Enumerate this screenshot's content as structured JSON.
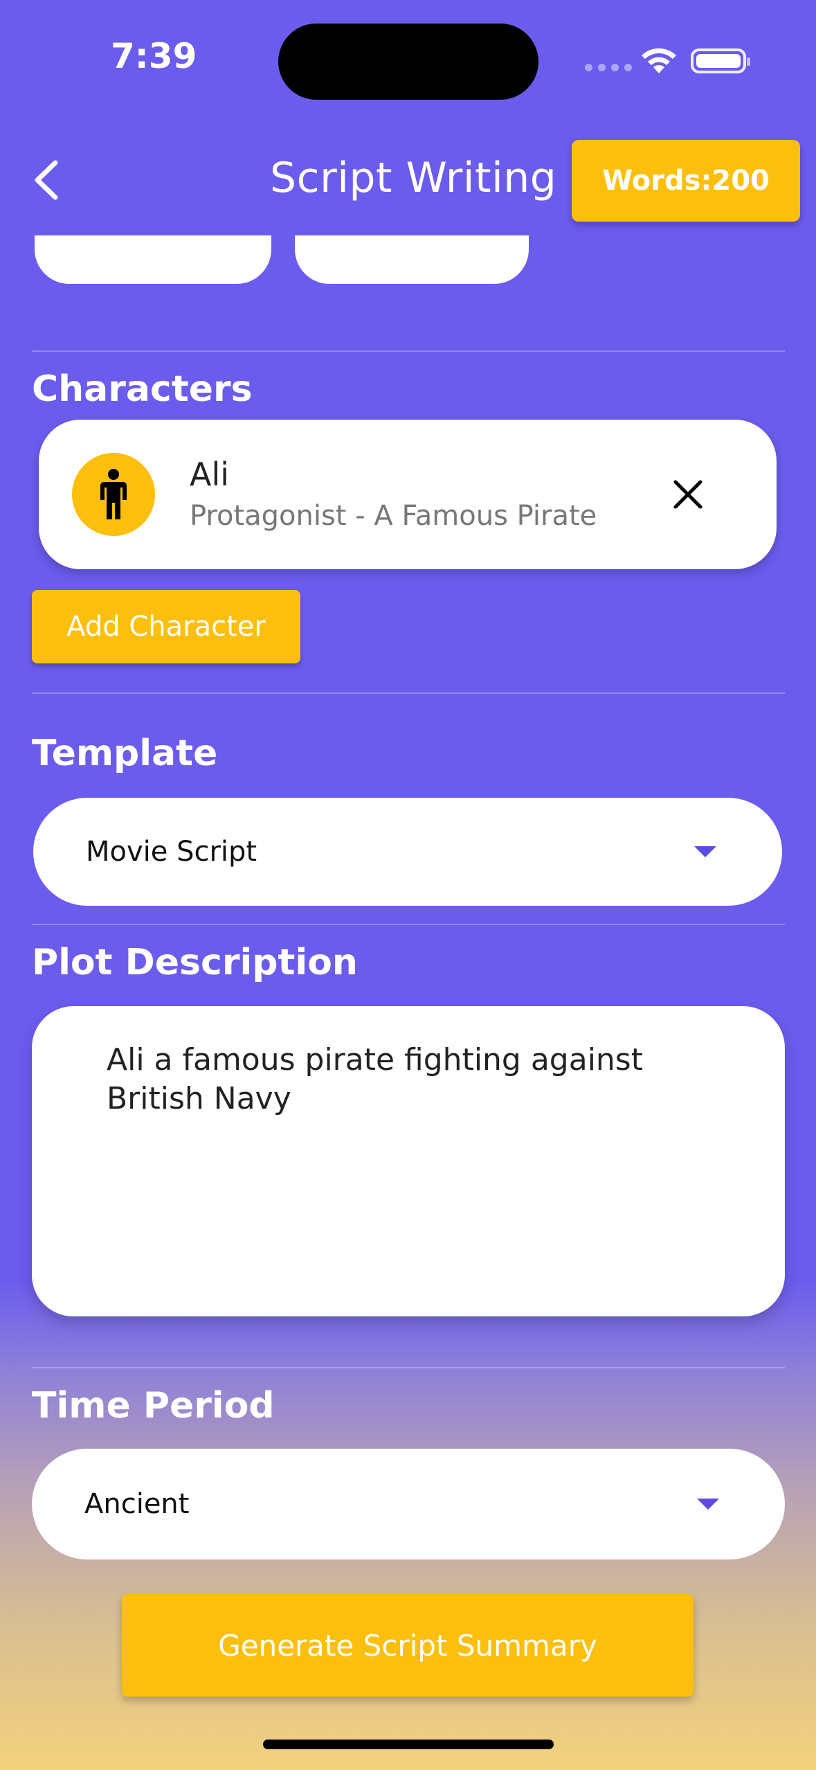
{
  "status_bar": {
    "time": "7:39"
  },
  "header": {
    "title": "Script Writing",
    "words_label": "Words:200"
  },
  "characters": {
    "label": "Characters",
    "items": [
      {
        "name": "Ali",
        "role": "Protagonist - A Famous Pirate"
      }
    ],
    "add_label": "Add Character"
  },
  "template": {
    "label": "Template",
    "value": "Movie Script"
  },
  "plot": {
    "label": "Plot Description",
    "value": "Ali a famous pirate fighting against British Navy"
  },
  "time_period": {
    "label": "Time Period",
    "value": "Ancient"
  },
  "generate_label": "Generate Script Summary",
  "colors": {
    "background": "#6b5cee",
    "accent": "#fdbf0e",
    "caret": "#5b4be0"
  },
  "icons": [
    "back-chevron-icon",
    "person-icon",
    "close-icon",
    "dropdown-caret-icon",
    "wifi-icon",
    "battery-icon"
  ]
}
